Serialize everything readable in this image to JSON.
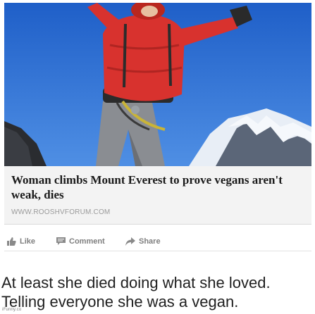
{
  "post": {
    "photo": {
      "description_icon": "mountain-climber-photo"
    },
    "link": {
      "title": "Woman climbs Mount Everest to prove vegans aren't weak, dies",
      "domain": "WWW.ROOSHVFORUM.COM"
    },
    "actions": [
      {
        "label": "Like",
        "icon": "thumbs-up-icon"
      },
      {
        "label": "Comment",
        "icon": "comment-icon"
      },
      {
        "label": "Share",
        "icon": "share-arrow-icon"
      }
    ]
  },
  "caption": {
    "line1": "At least she died doing what she loved.",
    "line2": "Telling everyone she was a vegan."
  },
  "watermark": "iFunny.co",
  "colors": {
    "sky": "#2f6fd0",
    "jacket": "#d8322e",
    "snow": "#f4f7fb",
    "action_text": "#7f7f7f"
  }
}
